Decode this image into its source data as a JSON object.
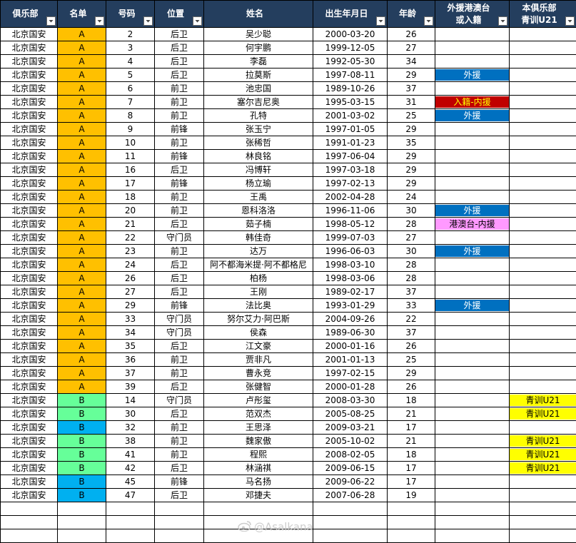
{
  "columns": [
    {
      "label": "俱乐部",
      "filter": true
    },
    {
      "label": "名单",
      "filter": true
    },
    {
      "label": "号码",
      "filter": true
    },
    {
      "label": "位置",
      "filter": true
    },
    {
      "label": "姓名",
      "filter": false
    },
    {
      "label": "出生年月日",
      "filter": true
    },
    {
      "label": "年龄",
      "filter": true
    },
    {
      "label": "外援港澳台\n或入籍",
      "filter": true
    },
    {
      "label": "本俱乐部\n青训U21",
      "filter": true
    }
  ],
  "colors": {
    "header_bg": "#243e5e",
    "list_A": "#ffc000",
    "list_B_green": "#66ff99",
    "list_B_blue": "#00b0f0",
    "foreign_aid": "#0070c0",
    "naturalized": "#c00000",
    "hmt": "#ff99ff",
    "youth": "#ffff00"
  },
  "rows": [
    {
      "club": "北京国安",
      "list": "A",
      "list_color": "A",
      "number": "2",
      "pos": "后卫",
      "name": "吴少聪",
      "dob": "2000-03-20",
      "age": "26",
      "status": "",
      "status_type": "",
      "youth": ""
    },
    {
      "club": "北京国安",
      "list": "A",
      "list_color": "A",
      "number": "3",
      "pos": "后卫",
      "name": "何宇鹏",
      "dob": "1999-12-05",
      "age": "27",
      "status": "",
      "status_type": "",
      "youth": ""
    },
    {
      "club": "北京国安",
      "list": "A",
      "list_color": "A",
      "number": "4",
      "pos": "后卫",
      "name": "李磊",
      "dob": "1992-05-30",
      "age": "34",
      "status": "",
      "status_type": "",
      "youth": ""
    },
    {
      "club": "北京国安",
      "list": "A",
      "list_color": "A",
      "number": "5",
      "pos": "后卫",
      "name": "拉莫斯",
      "dob": "1997-08-11",
      "age": "29",
      "status": "外援",
      "status_type": "foreign_aid",
      "youth": ""
    },
    {
      "club": "北京国安",
      "list": "A",
      "list_color": "A",
      "number": "6",
      "pos": "前卫",
      "name": "池忠国",
      "dob": "1989-10-26",
      "age": "37",
      "status": "",
      "status_type": "",
      "youth": ""
    },
    {
      "club": "北京国安",
      "list": "A",
      "list_color": "A",
      "number": "7",
      "pos": "前卫",
      "name": "塞尔吉尼奥",
      "dob": "1995-03-15",
      "age": "31",
      "status": "入籍-内援",
      "status_type": "naturalized",
      "youth": ""
    },
    {
      "club": "北京国安",
      "list": "A",
      "list_color": "A",
      "number": "8",
      "pos": "前卫",
      "name": "孔特",
      "dob": "2001-03-02",
      "age": "25",
      "status": "外援",
      "status_type": "foreign_aid",
      "youth": ""
    },
    {
      "club": "北京国安",
      "list": "A",
      "list_color": "A",
      "number": "9",
      "pos": "前锋",
      "name": "张玉宁",
      "dob": "1997-01-05",
      "age": "29",
      "status": "",
      "status_type": "",
      "youth": ""
    },
    {
      "club": "北京国安",
      "list": "A",
      "list_color": "A",
      "number": "10",
      "pos": "前卫",
      "name": "张稀哲",
      "dob": "1991-01-23",
      "age": "35",
      "status": "",
      "status_type": "",
      "youth": ""
    },
    {
      "club": "北京国安",
      "list": "A",
      "list_color": "A",
      "number": "11",
      "pos": "前锋",
      "name": "林良铭",
      "dob": "1997-06-04",
      "age": "29",
      "status": "",
      "status_type": "",
      "youth": ""
    },
    {
      "club": "北京国安",
      "list": "A",
      "list_color": "A",
      "number": "16",
      "pos": "后卫",
      "name": "冯博轩",
      "dob": "1997-03-18",
      "age": "29",
      "status": "",
      "status_type": "",
      "youth": ""
    },
    {
      "club": "北京国安",
      "list": "A",
      "list_color": "A",
      "number": "17",
      "pos": "前锋",
      "name": "杨立瑜",
      "dob": "1997-02-13",
      "age": "29",
      "status": "",
      "status_type": "",
      "youth": ""
    },
    {
      "club": "北京国安",
      "list": "A",
      "list_color": "A",
      "number": "18",
      "pos": "前卫",
      "name": "王禹",
      "dob": "2002-04-28",
      "age": "24",
      "status": "",
      "status_type": "",
      "youth": ""
    },
    {
      "club": "北京国安",
      "list": "A",
      "list_color": "A",
      "number": "20",
      "pos": "前卫",
      "name": "恩科洛洛",
      "dob": "1996-11-06",
      "age": "30",
      "status": "外援",
      "status_type": "foreign_aid",
      "youth": ""
    },
    {
      "club": "北京国安",
      "list": "A",
      "list_color": "A",
      "number": "21",
      "pos": "后卫",
      "name": "茹子楠",
      "dob": "1998-05-12",
      "age": "28",
      "status": "港澳台-内援",
      "status_type": "hmt",
      "youth": ""
    },
    {
      "club": "北京国安",
      "list": "A",
      "list_color": "A",
      "number": "22",
      "pos": "守门员",
      "name": "韩佳奇",
      "dob": "1999-07-03",
      "age": "27",
      "status": "",
      "status_type": "",
      "youth": ""
    },
    {
      "club": "北京国安",
      "list": "A",
      "list_color": "A",
      "number": "23",
      "pos": "前卫",
      "name": "达万",
      "dob": "1996-06-03",
      "age": "30",
      "status": "外援",
      "status_type": "foreign_aid",
      "youth": ""
    },
    {
      "club": "北京国安",
      "list": "A",
      "list_color": "A",
      "number": "24",
      "pos": "后卫",
      "name": "阿不都海米提·阿不都格尼",
      "dob": "1998-03-10",
      "age": "28",
      "status": "",
      "status_type": "",
      "youth": ""
    },
    {
      "club": "北京国安",
      "list": "A",
      "list_color": "A",
      "number": "26",
      "pos": "后卫",
      "name": "柏杨",
      "dob": "1998-03-06",
      "age": "28",
      "status": "",
      "status_type": "",
      "youth": ""
    },
    {
      "club": "北京国安",
      "list": "A",
      "list_color": "A",
      "number": "27",
      "pos": "后卫",
      "name": "王刚",
      "dob": "1989-02-17",
      "age": "37",
      "status": "",
      "status_type": "",
      "youth": ""
    },
    {
      "club": "北京国安",
      "list": "A",
      "list_color": "A",
      "number": "29",
      "pos": "前锋",
      "name": "法比奥",
      "dob": "1993-01-29",
      "age": "33",
      "status": "外援",
      "status_type": "foreign_aid",
      "youth": ""
    },
    {
      "club": "北京国安",
      "list": "A",
      "list_color": "A",
      "number": "33",
      "pos": "守门员",
      "name": "努尔艾力·阿巴斯",
      "dob": "2004-09-26",
      "age": "22",
      "status": "",
      "status_type": "",
      "youth": ""
    },
    {
      "club": "北京国安",
      "list": "A",
      "list_color": "A",
      "number": "34",
      "pos": "守门员",
      "name": "侯森",
      "dob": "1989-06-30",
      "age": "37",
      "status": "",
      "status_type": "",
      "youth": ""
    },
    {
      "club": "北京国安",
      "list": "A",
      "list_color": "A",
      "number": "35",
      "pos": "后卫",
      "name": "江文豪",
      "dob": "2000-01-16",
      "age": "26",
      "status": "",
      "status_type": "",
      "youth": ""
    },
    {
      "club": "北京国安",
      "list": "A",
      "list_color": "A",
      "number": "36",
      "pos": "前卫",
      "name": "贾非凡",
      "dob": "2001-01-13",
      "age": "25",
      "status": "",
      "status_type": "",
      "youth": ""
    },
    {
      "club": "北京国安",
      "list": "A",
      "list_color": "A",
      "number": "37",
      "pos": "前卫",
      "name": "曹永竞",
      "dob": "1997-02-15",
      "age": "29",
      "status": "",
      "status_type": "",
      "youth": ""
    },
    {
      "club": "北京国安",
      "list": "A",
      "list_color": "A",
      "number": "39",
      "pos": "后卫",
      "name": "张健智",
      "dob": "2000-01-28",
      "age": "26",
      "status": "",
      "status_type": "",
      "youth": ""
    },
    {
      "club": "北京国安",
      "list": "B",
      "list_color": "B_green",
      "number": "14",
      "pos": "守门员",
      "name": "卢彤玺",
      "dob": "2008-03-30",
      "age": "18",
      "status": "",
      "status_type": "",
      "youth": "青训U21"
    },
    {
      "club": "北京国安",
      "list": "B",
      "list_color": "B_green",
      "number": "30",
      "pos": "后卫",
      "name": "范双杰",
      "dob": "2005-08-25",
      "age": "21",
      "status": "",
      "status_type": "",
      "youth": "青训U21"
    },
    {
      "club": "北京国安",
      "list": "B",
      "list_color": "B_blue",
      "number": "32",
      "pos": "前卫",
      "name": "王思泽",
      "dob": "2009-03-21",
      "age": "17",
      "status": "",
      "status_type": "",
      "youth": ""
    },
    {
      "club": "北京国安",
      "list": "B",
      "list_color": "B_green",
      "number": "38",
      "pos": "前卫",
      "name": "魏家傲",
      "dob": "2005-10-02",
      "age": "21",
      "status": "",
      "status_type": "",
      "youth": "青训U21"
    },
    {
      "club": "北京国安",
      "list": "B",
      "list_color": "B_green",
      "number": "41",
      "pos": "前卫",
      "name": "程熙",
      "dob": "2008-02-05",
      "age": "18",
      "status": "",
      "status_type": "",
      "youth": "青训U21"
    },
    {
      "club": "北京国安",
      "list": "B",
      "list_color": "B_green",
      "number": "42",
      "pos": "后卫",
      "name": "林涵祺",
      "dob": "2009-06-15",
      "age": "17",
      "status": "",
      "status_type": "",
      "youth": "青训U21"
    },
    {
      "club": "北京国安",
      "list": "B",
      "list_color": "B_blue",
      "number": "45",
      "pos": "前锋",
      "name": "马名扬",
      "dob": "2009-06-22",
      "age": "17",
      "status": "",
      "status_type": "",
      "youth": ""
    },
    {
      "club": "北京国安",
      "list": "B",
      "list_color": "B_blue",
      "number": "47",
      "pos": "后卫",
      "name": "邓捷夫",
      "dob": "2007-06-28",
      "age": "19",
      "status": "",
      "status_type": "",
      "youth": ""
    }
  ],
  "empty_rows": 3,
  "watermark": "@Asalkana"
}
